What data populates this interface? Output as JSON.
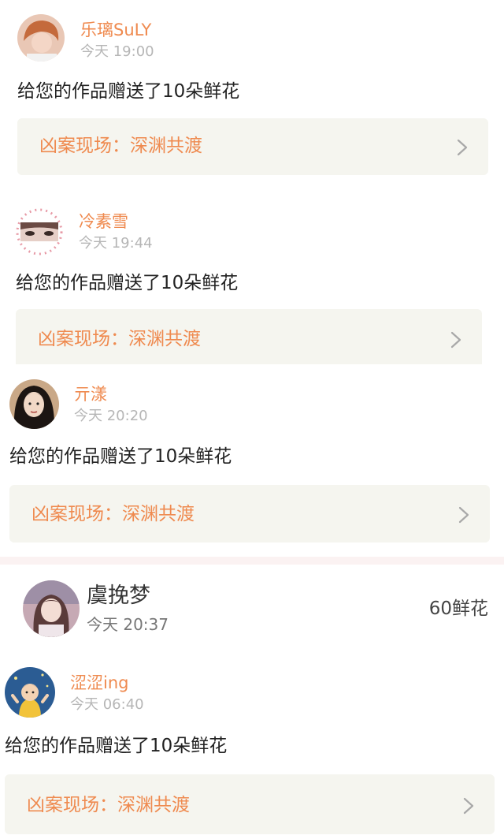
{
  "gifts": [
    {
      "user": "乐璃SuLY",
      "time": "今天 19:00",
      "message": "给您的作品赠送了10朵鲜花",
      "work": "凶案现场：深渊共渡"
    },
    {
      "user": "冷素雪",
      "time": "今天 19:44",
      "message": "给您的作品赠送了10朵鲜花",
      "work": "凶案现场：深渊共渡"
    },
    {
      "user": "亓漾",
      "time": "今天 20:20",
      "message": "给您的作品赠送了10朵鲜花",
      "work": "凶案现场：深渊共渡"
    },
    {
      "user": "涩涩ing",
      "time": "今天 06:40",
      "message": "给您的作品赠送了10朵鲜花",
      "work": "凶案现场：深渊共渡"
    }
  ],
  "summary": {
    "user": "虞挽梦",
    "time": "今天 20:37",
    "amount": "60鲜花"
  },
  "icons": {
    "chevron": "chevron-right-icon"
  },
  "colors": {
    "accent": "#ef8a4f",
    "card_bg": "#f5f5ef",
    "divider": "#fbf2f2"
  }
}
